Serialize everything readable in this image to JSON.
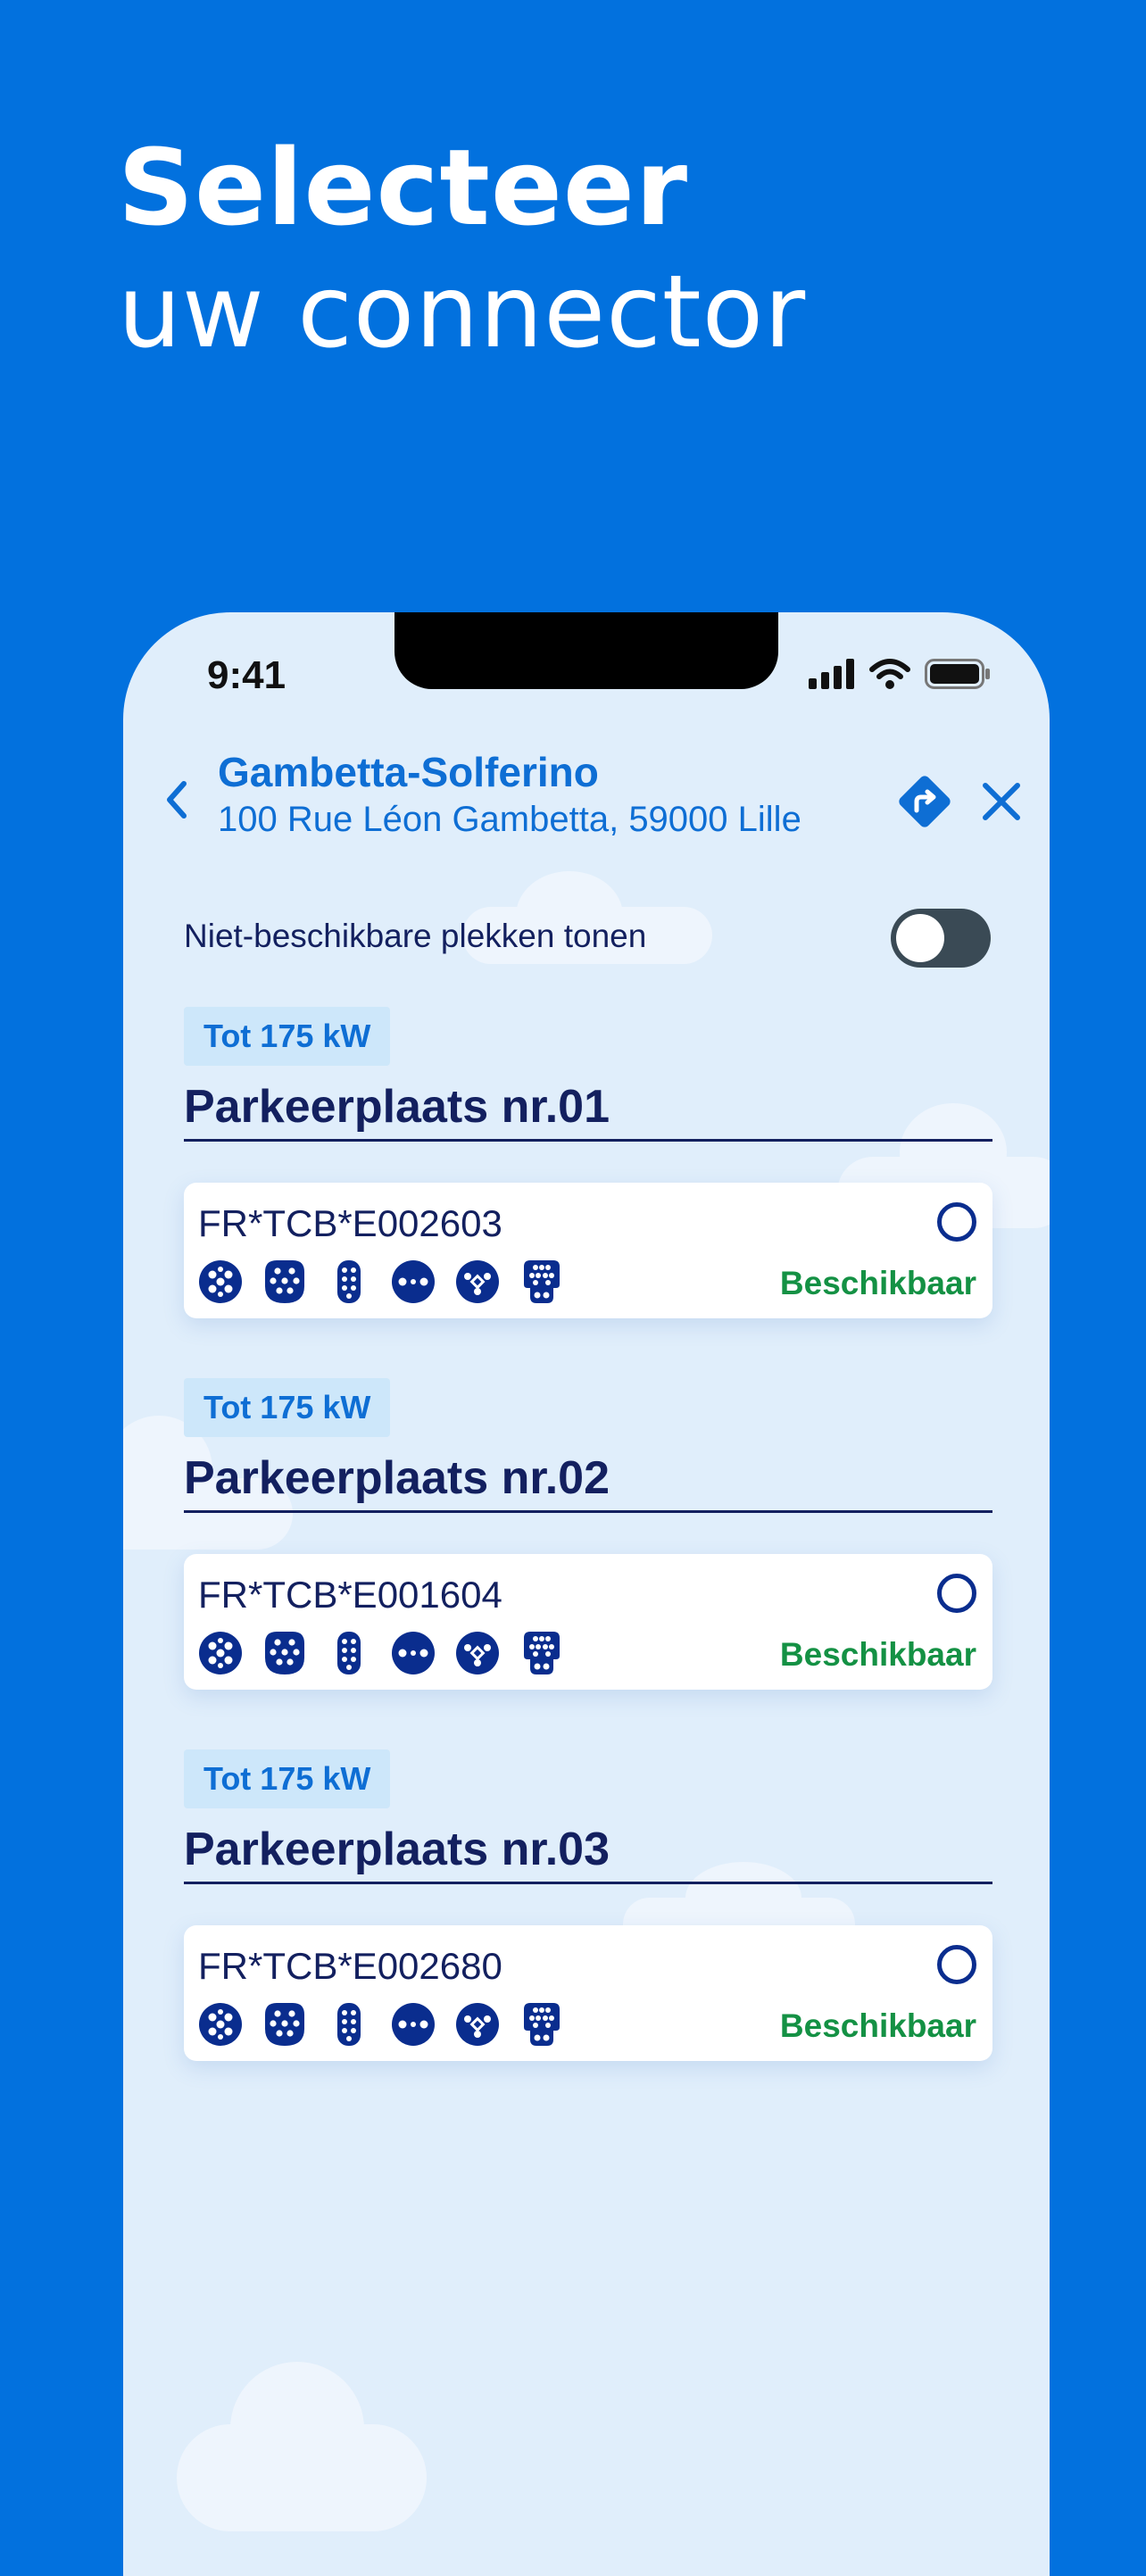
{
  "headline": {
    "line1": "Selecteer",
    "line2": "uw connector"
  },
  "status_bar": {
    "time": "9:41",
    "icons": [
      "signal-icon",
      "wifi-icon",
      "battery-icon"
    ]
  },
  "station": {
    "name": "Gambetta-Solferino",
    "address": "100 Rue Léon Gambetta, 59000 Lille"
  },
  "toggle": {
    "label": "Niet-beschikbare plekken tonen",
    "on": false
  },
  "connector_icons": [
    "type2-plug-icon",
    "ccs-plug-icon",
    "chademo-plug-icon",
    "domestic-plug-icon",
    "type3-plug-icon",
    "combo-plug-icon"
  ],
  "spots": [
    {
      "power": "Tot 175 kW",
      "title": "Parkeerplaats nr.01",
      "evse_id": "FR*TCB*E002603",
      "status": "Beschikbaar"
    },
    {
      "power": "Tot 175 kW",
      "title": "Parkeerplaats nr.02",
      "evse_id": "FR*TCB*E001604",
      "status": "Beschikbaar"
    },
    {
      "power": "Tot 175 kW",
      "title": "Parkeerplaats nr.03",
      "evse_id": "FR*TCB*E002680",
      "status": "Beschikbaar"
    }
  ],
  "colors": {
    "background": "#0271DE",
    "accent": "#0E6ED4",
    "navy": "#13205F",
    "available": "#149144"
  }
}
